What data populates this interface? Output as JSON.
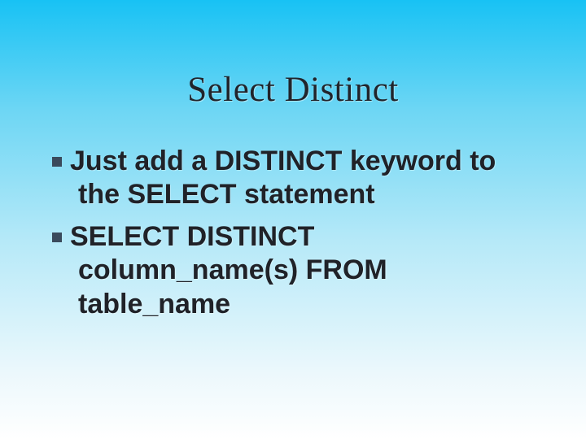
{
  "title": "Select Distinct",
  "bullets": [
    {
      "first": "Just add a DISTINCT keyword to",
      "cont": "the SELECT statement"
    },
    {
      "first": "SELECT DISTINCT",
      "cont": "column_name(s) FROM table_name"
    }
  ]
}
